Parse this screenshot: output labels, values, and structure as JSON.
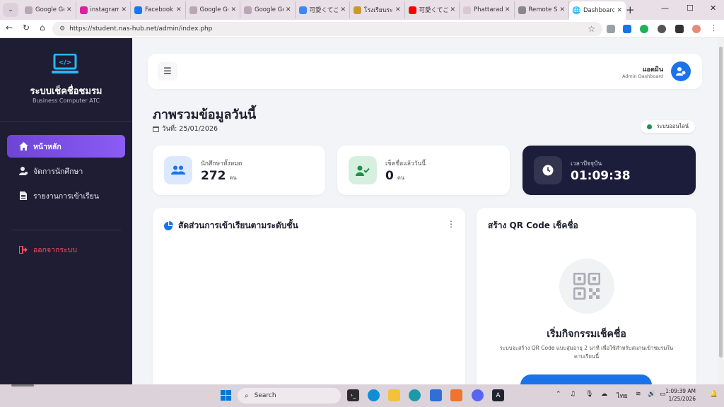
{
  "browser": {
    "tabs": [
      {
        "title": "Google Ge",
        "favicon": "play-icon",
        "color": "#b9a7b5"
      },
      {
        "title": "instagram",
        "favicon": "instagram-icon",
        "color": "#d6249f"
      },
      {
        "title": "Facebook",
        "favicon": "facebook-icon",
        "color": "#1877f2"
      },
      {
        "title": "Google Ge",
        "favicon": "play-icon",
        "color": "#b9a7b5"
      },
      {
        "title": "Google Ge",
        "favicon": "play-icon",
        "color": "#b9a7b5"
      },
      {
        "title": "可愛くてごめ",
        "favicon": "google-icon",
        "color": "#4285f4"
      },
      {
        "title": "โรงเรียนระยอ",
        "favicon": "school-icon",
        "color": "#c79a2b"
      },
      {
        "title": "可愛くてごめ",
        "favicon": "youtube-icon",
        "color": "#ff0000"
      },
      {
        "title": "Phattaradi",
        "favicon": "page-icon",
        "color": "#d9c8d4"
      },
      {
        "title": "Remote Su",
        "favicon": "remote-icon",
        "color": "#888888"
      }
    ],
    "active_tab": {
      "title": "Dashboard",
      "favicon": "globe-icon"
    },
    "url": "https://student.nas-hub.net/admin/index.php"
  },
  "sidebar": {
    "brand_title": "ระบบเช็คชื่อชมรม",
    "brand_subtitle": "Business Computer ATC",
    "menu": [
      {
        "label": "หน้าหลัก",
        "icon": "home-icon",
        "active": true
      },
      {
        "label": "จัดการนักศึกษา",
        "icon": "user-gear-icon",
        "active": false
      },
      {
        "label": "รายงานการเข้าเรียน",
        "icon": "document-icon",
        "active": false
      }
    ],
    "logout_label": "ออกจากระบบ"
  },
  "topbar": {
    "menu_icon": "hamburger-icon",
    "user_name": "แอดมิน",
    "user_role": "Admin Dashboard"
  },
  "page": {
    "title": "ภาพรวมข้อมูลวันนี้",
    "date": "วันที่: 25/01/2026",
    "status": "ระบบออนไลน์"
  },
  "stats": [
    {
      "label": "นักศึกษาทั้งหมด",
      "value": "272",
      "unit": "คน",
      "icon": "users-icon",
      "color": "#1a73e8"
    },
    {
      "label": "เช็คชื่อแล้ววันนี้",
      "value": "0",
      "unit": "คน",
      "icon": "user-check-icon",
      "color": "#1f8f4e"
    },
    {
      "label": "เวลาปัจจุบัน",
      "value": "01:09:38",
      "icon": "clock-icon"
    }
  ],
  "chart_card": {
    "title": "สัดส่วนการเข้าเรียนตามระดับชั้น",
    "icon": "pie-chart-icon"
  },
  "qr_card": {
    "title": "สร้าง QR Code เช็คชื่อ",
    "heading": "เริ่มกิจกรรมเช็คชื่อ",
    "description": "ระบบจะสร้าง QR Code แบบสุ่มอายุ 2 นาที เพื่อใช้สำหรับสแกนเข้าชมรมในคาบเรียนนี้"
  },
  "taskbar": {
    "search_placeholder": "Search",
    "lang": "ไทย",
    "time": "1:09:39 AM",
    "date": "1/25/2026"
  },
  "colors": {
    "accent": "#7c4dff",
    "sidebar": "#1f1d33",
    "primary": "#1a73e8",
    "danger": "#ff4d5e"
  }
}
